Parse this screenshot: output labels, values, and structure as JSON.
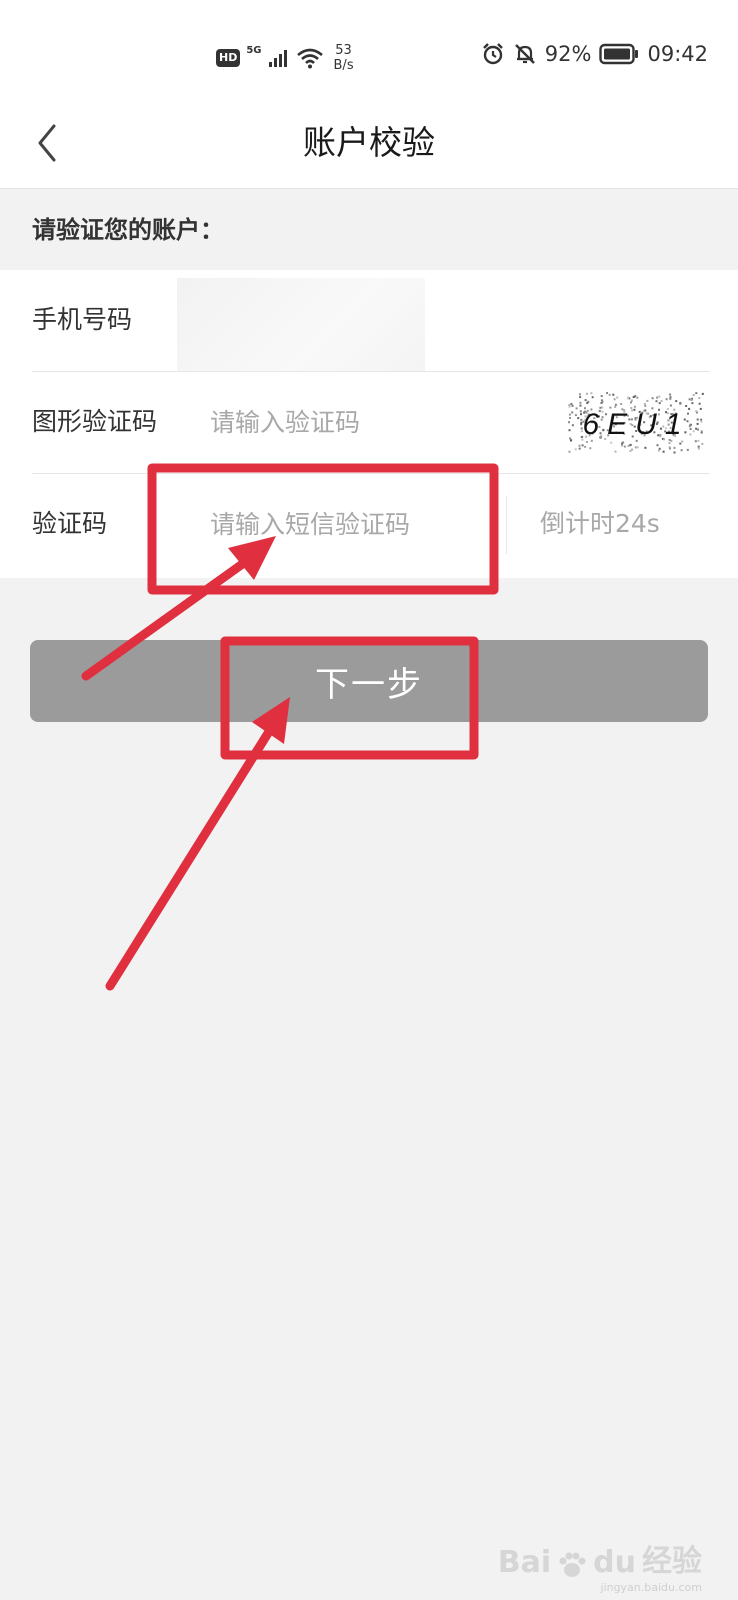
{
  "status_bar": {
    "hd": "HD",
    "network": "5G",
    "speed_value": "53",
    "speed_unit": "B/s",
    "battery": "92%",
    "time": "09:42",
    "icons": [
      "signal-icon",
      "wifi-icon",
      "alarm-icon",
      "mute-bell-icon",
      "battery-icon"
    ]
  },
  "nav": {
    "back_icon": "chevron-left-icon",
    "title": "账户校验"
  },
  "section_header": "请验证您的账户：",
  "form": {
    "phone": {
      "label": "手机号码",
      "value": ""
    },
    "captcha": {
      "label": "图形验证码",
      "placeholder": "请输入验证码",
      "image_text": "6EU1"
    },
    "sms": {
      "label": "验证码",
      "placeholder": "请输入短信验证码",
      "countdown": "倒计时24s"
    }
  },
  "next_button": "下一步",
  "colors": {
    "button_disabled": "#9b9b9b",
    "annotation_red": "#e0303f",
    "background": "#f2f2f2",
    "placeholder": "#a8a8a8"
  },
  "watermark": {
    "brand": "Bai",
    "brand_mark": "du",
    "suffix": "经验",
    "url": "jingyan.baidu.com"
  }
}
